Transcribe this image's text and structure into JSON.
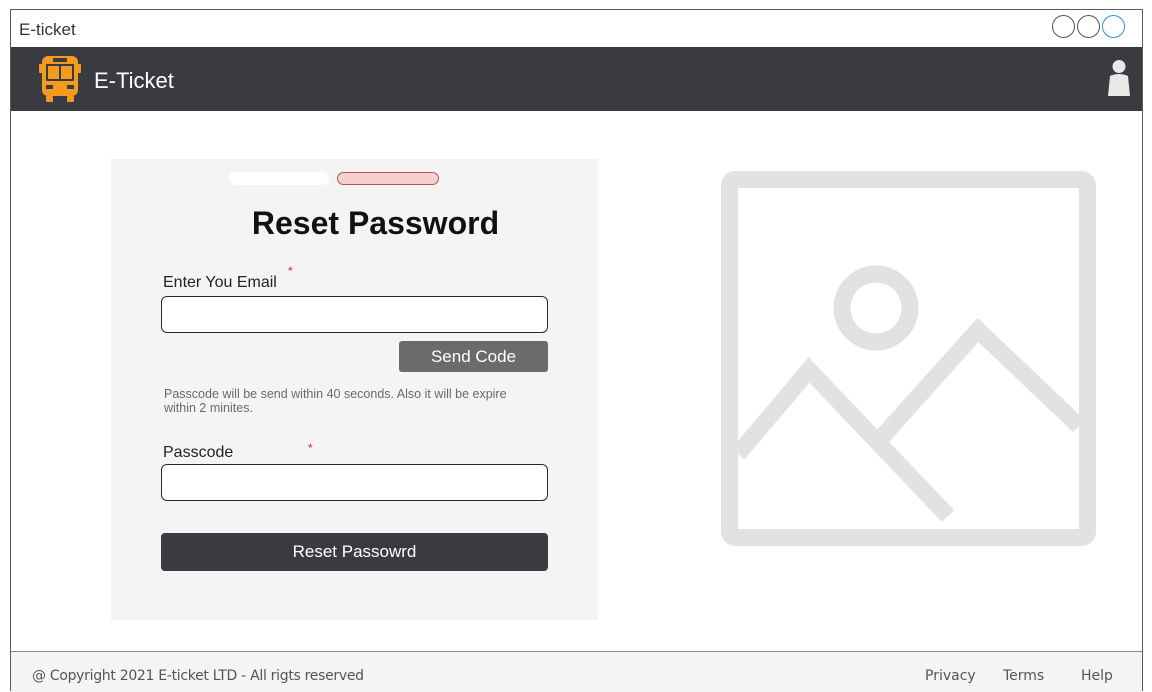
{
  "window": {
    "title": "E-ticket"
  },
  "header": {
    "brand": "E-Ticket",
    "bus_icon": "bus-icon",
    "user_icon": "user-icon"
  },
  "reset_form": {
    "title": "Reset Password",
    "email_label": "Enter You Email",
    "email_value": "",
    "required_mark": "*",
    "send_code_label": "Send Code",
    "hint_text": "Passcode will be send within 40 seconds. Also it will be expire within 2 minites.",
    "passcode_label": "Passcode",
    "passcode_value": "",
    "reset_button_label": "Reset Passowrd",
    "steps": [
      {
        "state": "inactive",
        "color": "#ffffff"
      },
      {
        "state": "active",
        "color": "#f6cfcf"
      }
    ]
  },
  "image_placeholder": {
    "icon": "image-placeholder-icon",
    "color": "#e2e2e2"
  },
  "footer": {
    "copyright": "@ Copyright 2021 E-ticket LTD - All rigts reserved",
    "links": [
      "Privacy",
      "Terms",
      "Help"
    ]
  },
  "colors": {
    "navbar": "#393b40",
    "accent_bus": "#f39a21",
    "required": "#e0262b",
    "card": "#f4f4f4"
  }
}
